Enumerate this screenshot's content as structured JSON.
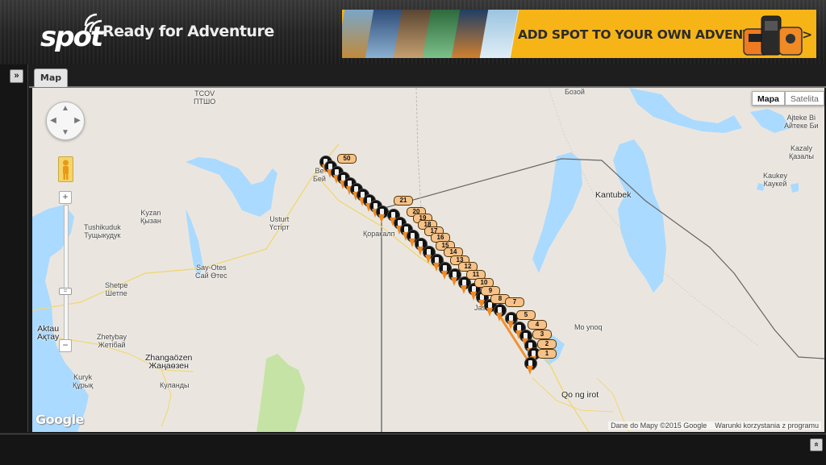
{
  "header": {
    "logo_text": "spot",
    "tagline": "Ready for Adventure",
    "banner_text": "ADD SPOT TO YOUR OWN ADVENTURES >>",
    "colors": {
      "banner_bg": "#f7b416",
      "header_bg": "#2a2a2a"
    }
  },
  "side": {
    "expand_icon": "»",
    "collapse_icon": "»"
  },
  "tabs": [
    {
      "label": "Map",
      "active": true
    }
  ],
  "map": {
    "controls": {
      "zoom_in": "+",
      "zoom_out": "−",
      "zoom_thumb": "="
    },
    "maptype": {
      "map": "Mapa",
      "satellite": "Satelita",
      "selected": "Mapa"
    },
    "google_logo": "Google",
    "attribution": "Dane do Mapy ©2015 Google",
    "terms": "Warunki korzystania z programu",
    "labels": [
      {
        "text": "TCOV\nПТШО"
      },
      {
        "text": "Бозой"
      },
      {
        "text": "Ajteke Bi\nАйтеке Би"
      },
      {
        "text": "Kazaly\nҚазалы"
      },
      {
        "text": "Kaukey\nКаукей"
      },
      {
        "text": "Kantubek"
      },
      {
        "text": "Kyzan\nҚызан"
      },
      {
        "text": "Tushikuduk\nТущыкудук"
      },
      {
        "text": "Usturt\nҮстірт"
      },
      {
        "text": "Be\nБей"
      },
      {
        "text": "Қоракалп"
      },
      {
        "text": "Say-Otes\nСай Өтес"
      },
      {
        "text": "Shetpe\nШетпе"
      },
      {
        "text": "Aktau\nАқтау"
      },
      {
        "text": "Zhetybay\nЖетібай"
      },
      {
        "text": "Zhangaözen\nЖаңаөзен"
      },
      {
        "text": "Kuryk\nҚұрық"
      },
      {
        "text": "Куланды"
      },
      {
        "text": "Mo ynoq"
      },
      {
        "text": "Qo ng irot"
      },
      {
        "text": "Jas"
      }
    ],
    "markers": [
      "1",
      "2",
      "3",
      "4",
      "5",
      "7",
      "8",
      "9",
      "10",
      "11",
      "12",
      "13",
      "14",
      "15",
      "16",
      "17",
      "18",
      "19",
      "20",
      "21",
      "50"
    ],
    "colors": {
      "water": "#aadaff",
      "land": "#eae6df",
      "green": "#c5e3a5",
      "route": "#f08a24",
      "pin": "#111111",
      "badge": "#f5c28a"
    }
  }
}
